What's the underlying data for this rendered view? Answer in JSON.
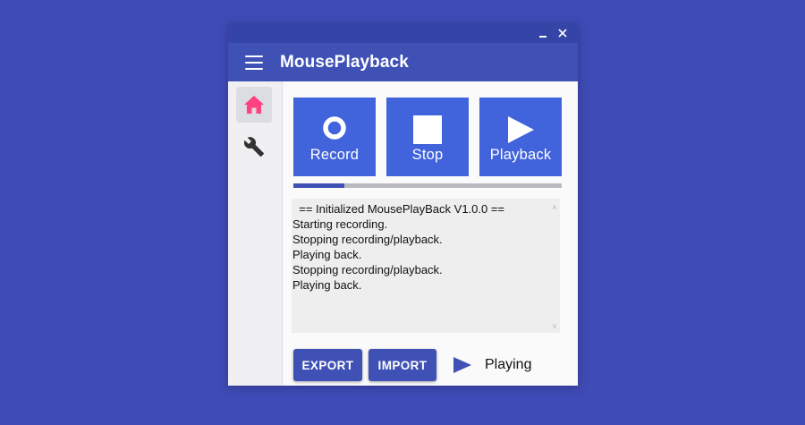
{
  "window": {
    "title": "MousePlayback",
    "controls": [
      {
        "name": "minimize",
        "icon": "minimize-icon",
        "glyph": "_"
      },
      {
        "name": "close",
        "icon": "close-icon",
        "glyph": "✕"
      }
    ]
  },
  "sidebar": {
    "items": [
      {
        "name": "home",
        "icon": "home-icon",
        "active": true
      },
      {
        "name": "settings",
        "icon": "wrench-icon",
        "active": false
      }
    ]
  },
  "controls": {
    "record_label": "Record",
    "stop_label": "Stop",
    "playback_label": "Playback"
  },
  "progress": {
    "fraction": 0.19
  },
  "log": {
    "lines": [
      "  == Initialized MousePlayBack V1.0.0 ==",
      "Starting recording.",
      "Stopping recording/playback.",
      "Playing back.",
      "Stopping recording/playback.",
      "Playing back."
    ]
  },
  "footer": {
    "export_label": "EXPORT",
    "import_label": "IMPORT",
    "status_icon": "play-icon",
    "status_text": "Playing"
  },
  "colors": {
    "background": "#3f4bb6",
    "titlebar": "#3444a7",
    "appbar": "#3f51b5",
    "big_button": "#4163dc",
    "home_icon": "#ff4081",
    "accent": "#3f51b5"
  }
}
